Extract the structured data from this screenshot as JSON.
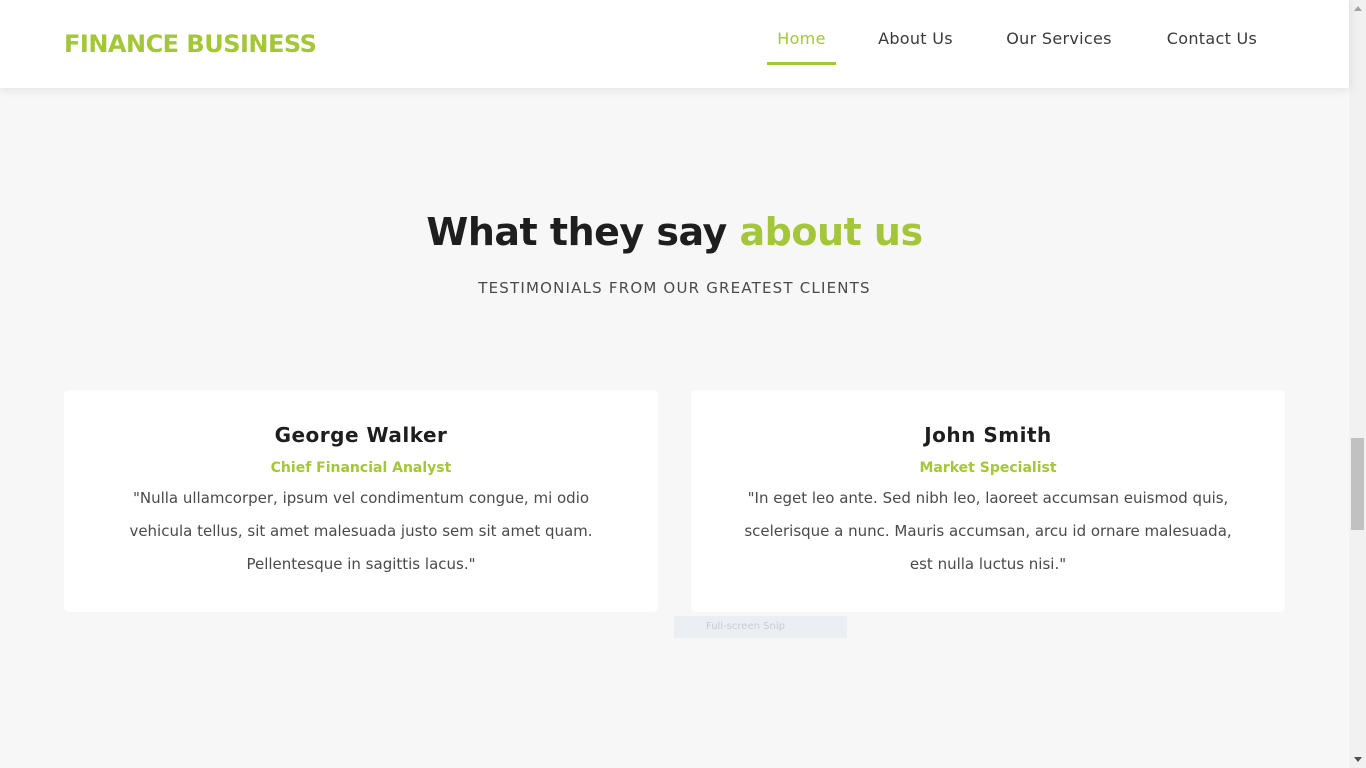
{
  "header": {
    "logo": "FINANCE BUSINESS",
    "nav": [
      {
        "label": "Home",
        "active": true
      },
      {
        "label": "About Us",
        "active": false
      },
      {
        "label": "Our Services",
        "active": false
      },
      {
        "label": "Contact Us",
        "active": false
      }
    ]
  },
  "section": {
    "title_main": "What they say",
    "title_accent": "about us",
    "subtitle": "TESTIMONIALS FROM OUR GREATEST CLIENTS"
  },
  "testimonials": [
    {
      "name": "George Walker",
      "role": "Chief Financial Analyst",
      "quote": "\"Nulla ullamcorper, ipsum vel condimentum congue, mi odio vehicula tellus, sit amet malesuada justo sem sit amet quam. Pellentesque in sagittis lacus.\""
    },
    {
      "name": "John Smith",
      "role": "Market Specialist",
      "quote": "\"In eget leo ante. Sed nibh leo, laoreet accumsan euismod quis, scelerisque a nunc. Mauris accumsan, arcu id ornare malesuada, est nulla luctus nisi.\""
    }
  ],
  "overlay": {
    "snip_label": "Full-screen Snip"
  },
  "colors": {
    "accent": "#a4c639",
    "heading": "#1e1e1e",
    "body_text": "#4a4a4a",
    "background": "#f7f7f7",
    "card": "#ffffff"
  }
}
